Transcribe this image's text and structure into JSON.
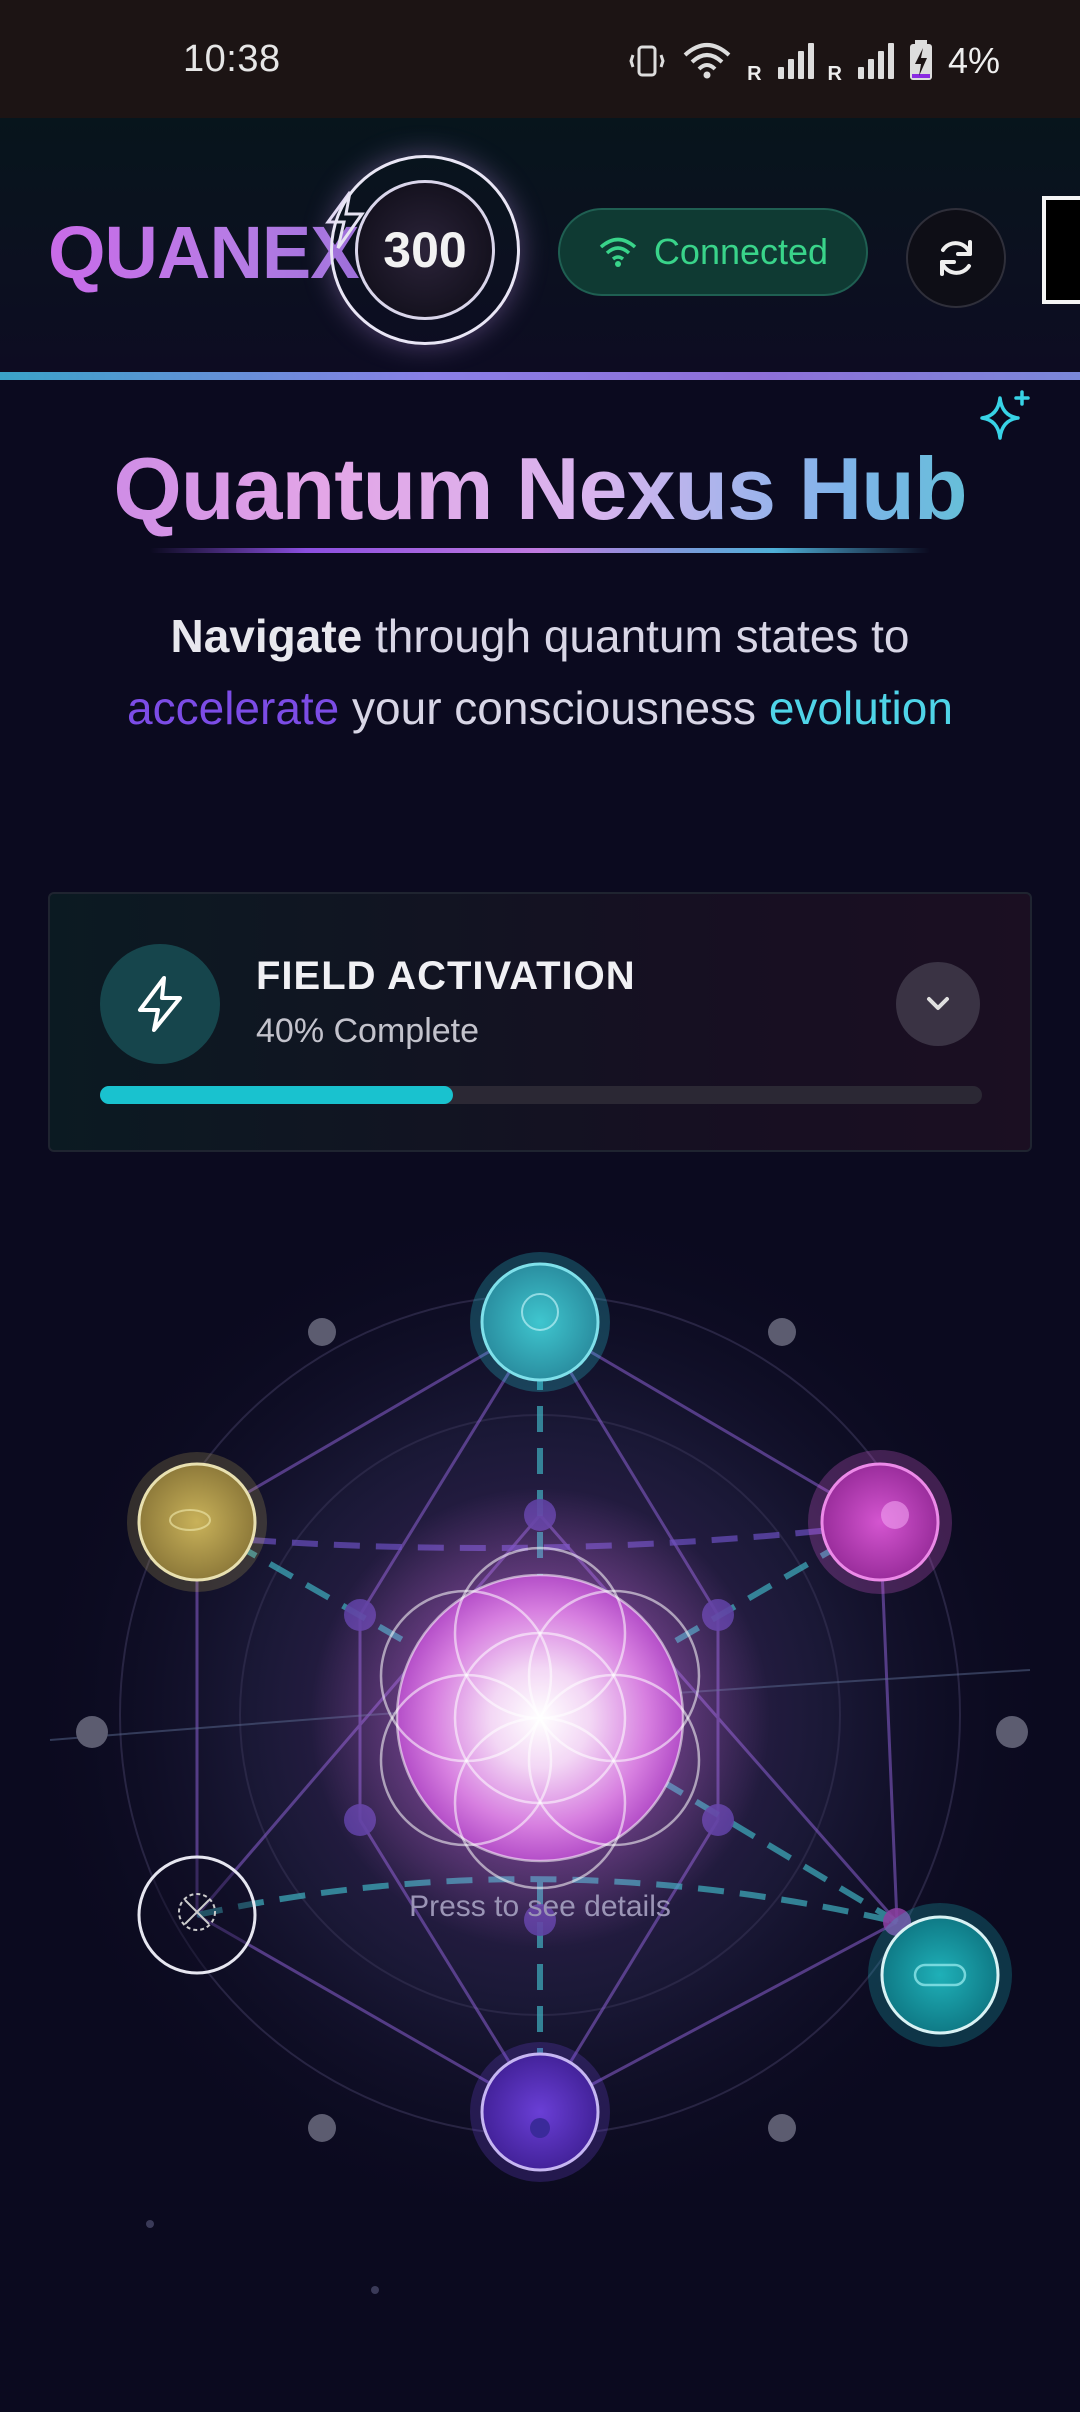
{
  "status_bar": {
    "time": "10:38",
    "network_label": "R",
    "battery_percent": "4%"
  },
  "header": {
    "logo": "QUANEX",
    "score": "300",
    "connection_status": "Connected"
  },
  "hero": {
    "title": "Quantum Nexus Hub",
    "subtitle_bold": "Navigate",
    "subtitle_part1": " through quantum states to",
    "subtitle_highlight1": "accelerate",
    "subtitle_part2": " your consciousness ",
    "subtitle_highlight2": "evolution"
  },
  "field_card": {
    "title": "FIELD ACTIVATION",
    "status": "40% Complete",
    "progress": 0.4
  },
  "visualization": {
    "hint": "Press to see details",
    "nodes": [
      "cyan-node",
      "magenta-node",
      "teal-node",
      "violet-node",
      "white-outline-node",
      "gold-node",
      "central-core"
    ]
  },
  "colors": {
    "accent_cyan": "#19c2cf",
    "accent_purple": "#7c4ce6",
    "connected_green": "#39d48a",
    "background": "#0b0a1f"
  }
}
